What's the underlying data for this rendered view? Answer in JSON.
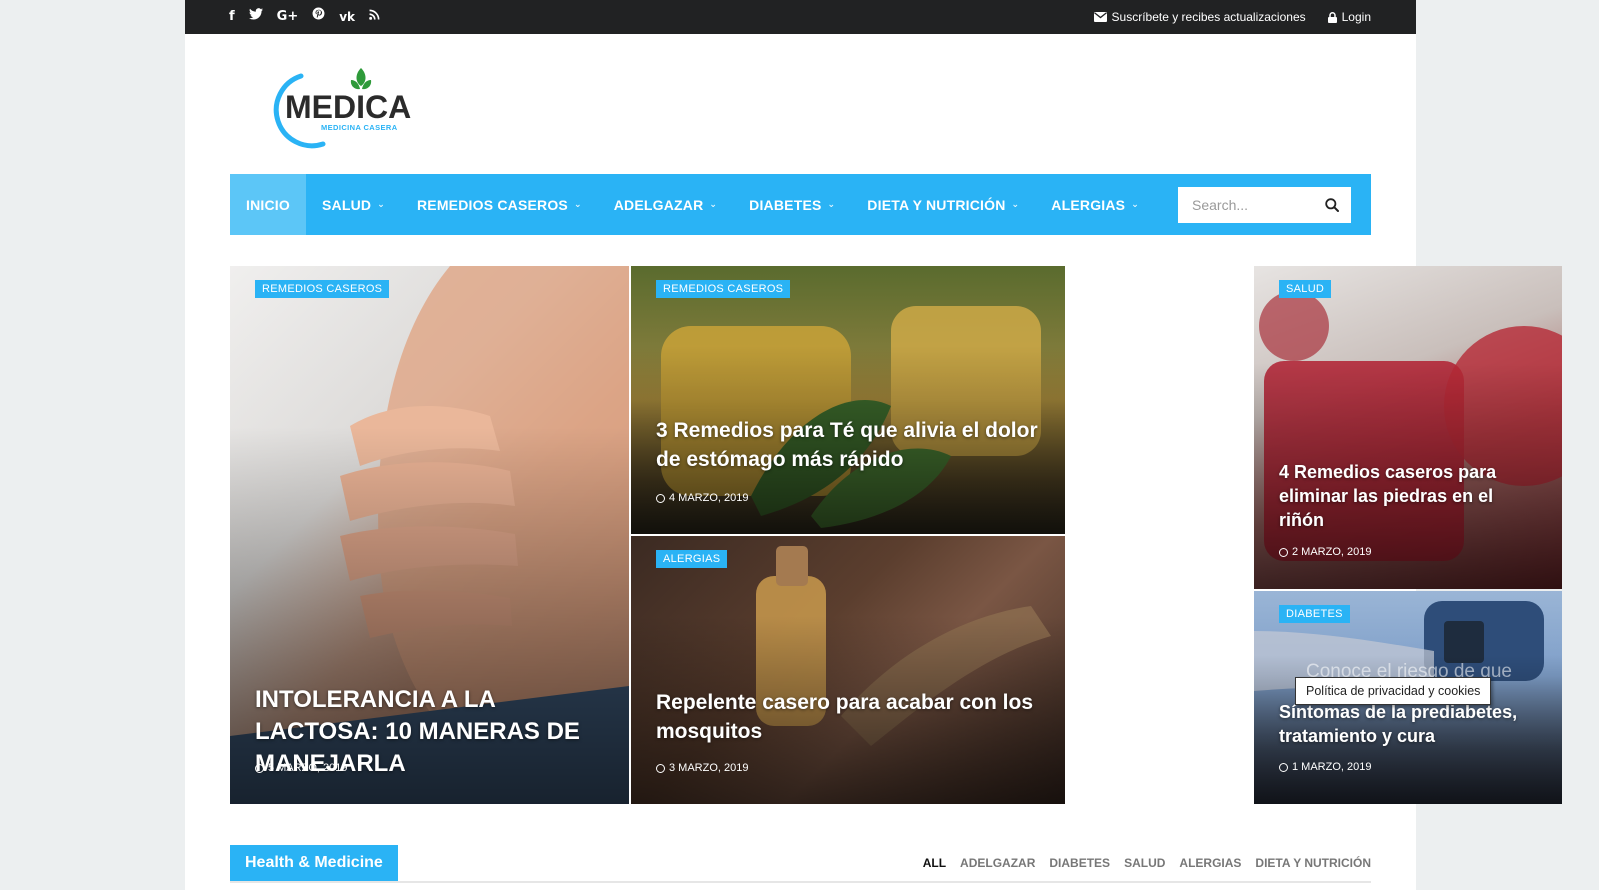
{
  "colors": {
    "accent": "#2ab3f5",
    "topbar": "#212223",
    "page_bg": "#eceff0"
  },
  "topbar": {
    "social": [
      {
        "name": "facebook-icon",
        "glyph": "f"
      },
      {
        "name": "twitter-icon",
        "glyph": "🐦"
      },
      {
        "name": "google-plus-icon",
        "glyph": "G+"
      },
      {
        "name": "pinterest-icon",
        "glyph": "P"
      },
      {
        "name": "vk-icon",
        "glyph": "vk"
      },
      {
        "name": "rss-icon",
        "glyph": ")"
      }
    ],
    "subscribe": "Suscríbete y recibes actualizaciones",
    "login": "Login"
  },
  "logo": {
    "name": "MEDICA",
    "tagline": "MEDICINA CASERA"
  },
  "nav": {
    "items": [
      {
        "label": "INICIO",
        "active": true,
        "dropdown": false
      },
      {
        "label": "SALUD",
        "active": false,
        "dropdown": true
      },
      {
        "label": "REMEDIOS CASEROS",
        "active": false,
        "dropdown": true
      },
      {
        "label": "ADELGAZAR",
        "active": false,
        "dropdown": true
      },
      {
        "label": "DIABETES",
        "active": false,
        "dropdown": true
      },
      {
        "label": "DIETA Y NUTRICIÓN",
        "active": false,
        "dropdown": true
      },
      {
        "label": "ALERGIAS",
        "active": false,
        "dropdown": true
      }
    ],
    "search_placeholder": "Search..."
  },
  "featured": [
    {
      "category": "REMEDIOS CASEROS",
      "title": "INTOLERANCIA A LA LACTOSA: 10 MANERAS DE MANEJARLA",
      "date": "5 MARZO, 2019"
    },
    {
      "category": "REMEDIOS CASEROS",
      "title": "3 Remedios para Té que alivia el dolor de estómago más rápido",
      "date": "4 MARZO, 2019"
    },
    {
      "category": "SALUD",
      "title": "4 Remedios caseros para eliminar las piedras en el riñón",
      "date": "2 MARZO, 2019"
    },
    {
      "category": "ALERGIAS",
      "title": "Repelente casero para acabar con los mosquitos",
      "date": "3 MARZO, 2019"
    },
    {
      "category": "DIABETES",
      "title": "Síntomas de la prediabetes, tratamiento y cura",
      "date": "1 MARZO, 2019",
      "overlay_text": "Conoce el riesgo de que desarrolles diabet"
    }
  ],
  "tooltip": "Política de privacidad y cookies",
  "section": {
    "title": "Health & Medicine",
    "filters": [
      "ALL",
      "ADELGAZAR",
      "DIABETES",
      "SALUD",
      "ALERGIAS",
      "DIETA Y NUTRICIÓN"
    ]
  }
}
